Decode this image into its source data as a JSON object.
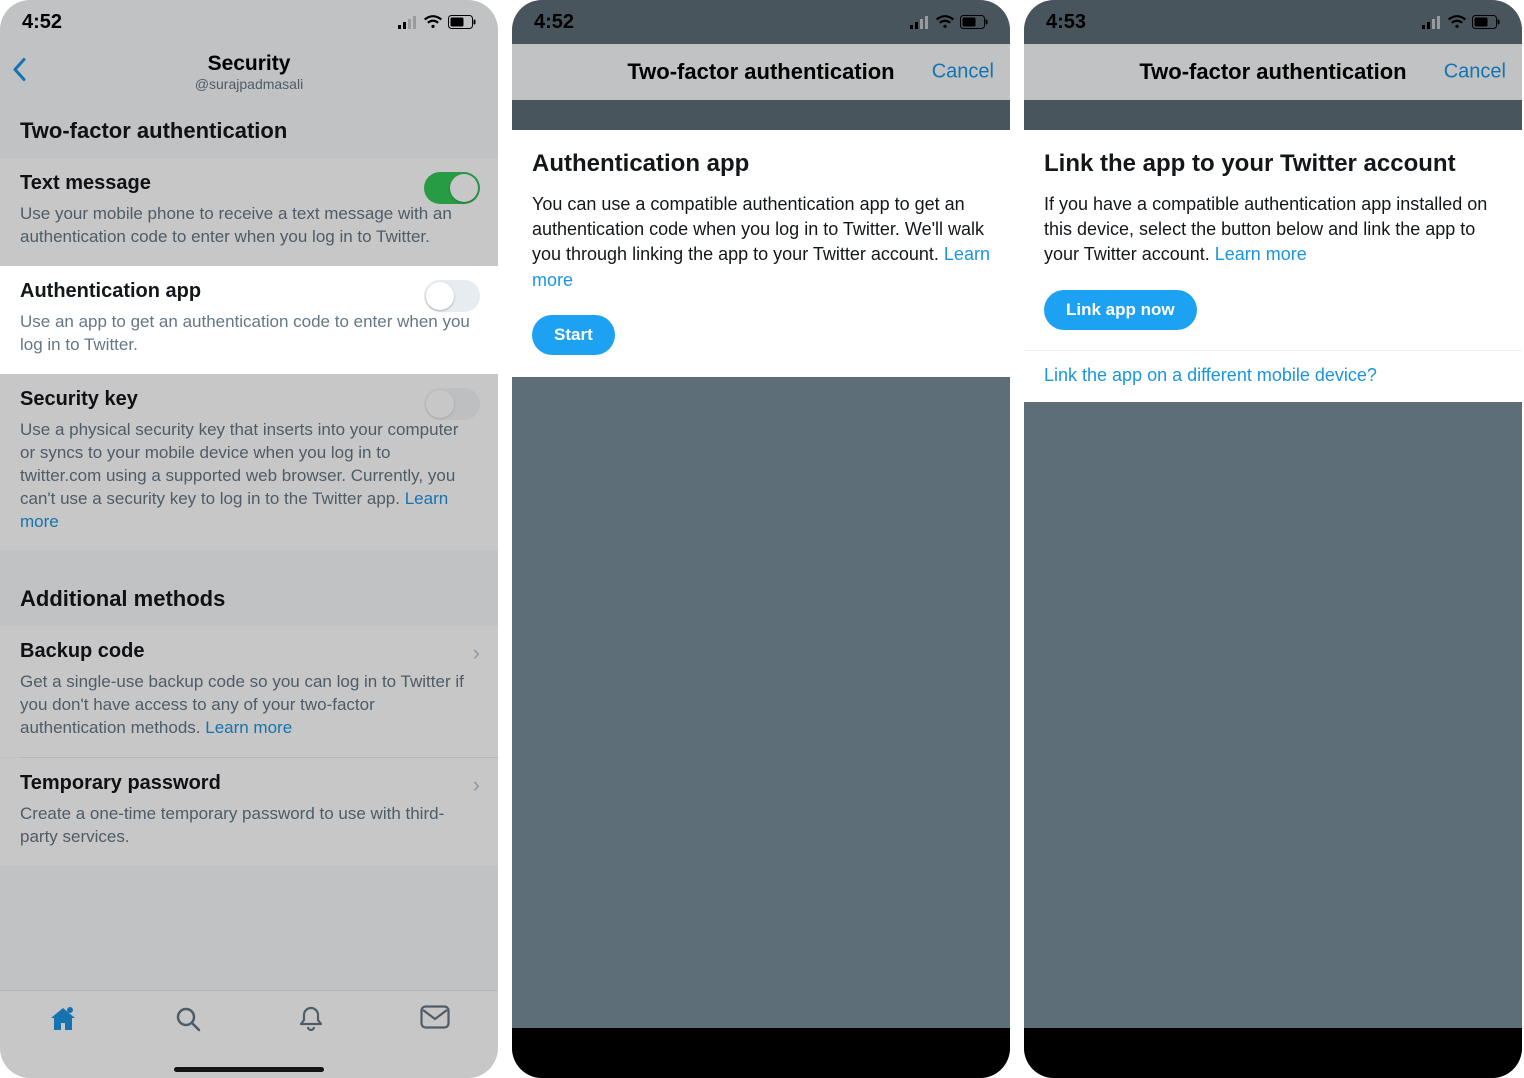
{
  "phone1": {
    "time": "4:52",
    "nav": {
      "title": "Security",
      "subtitle": "@surajpadmasali"
    },
    "section_twofa": "Two-factor authentication",
    "text_message": {
      "label": "Text message",
      "desc": "Use your mobile phone to receive a text message with an authentication code to enter when you log in to Twitter."
    },
    "auth_app": {
      "label": "Authentication app",
      "desc": "Use an app to get an authentication code to enter when you log in to Twitter."
    },
    "security_key": {
      "label": "Security key",
      "desc": "Use a physical security key that inserts into your computer or syncs to your mobile device when you log in to  twitter.com using a supported web browser. Currently, you can't use a security key to log in to the Twitter app. ",
      "learn_more": "Learn more"
    },
    "additional_methods": "Additional methods",
    "backup_code": {
      "label": "Backup code",
      "desc": "Get a single-use backup code so you can log in to Twitter if you don't have access to any of your two-factor authentication methods. ",
      "learn_more": "Learn more"
    },
    "temp_password": {
      "label": "Temporary password",
      "desc": "Create a one-time temporary password to use with third-party services."
    }
  },
  "phone2": {
    "time": "4:52",
    "nav": {
      "title": "Two-factor authentication",
      "cancel": "Cancel"
    },
    "heading": "Authentication app",
    "body": "You can use a compatible authentication app to get an authentication code when you log in to Twitter. We'll walk you through linking the app to your Twitter account. ",
    "learn_more": "Learn more",
    "start": "Start"
  },
  "phone3": {
    "time": "4:53",
    "nav": {
      "title": "Two-factor authentication",
      "cancel": "Cancel"
    },
    "heading": "Link the app to your Twitter account",
    "body": "If you have a compatible authentication app installed on this device, select the button below and link the app to your Twitter account. ",
    "learn_more": "Learn more",
    "link_now": "Link app now",
    "other_device": "Link the app on a different mobile device?"
  },
  "colors": {
    "accent": "#1da1f2",
    "link": "#1b95e0",
    "muted": "#657786",
    "toggle_on": "#34c759"
  }
}
